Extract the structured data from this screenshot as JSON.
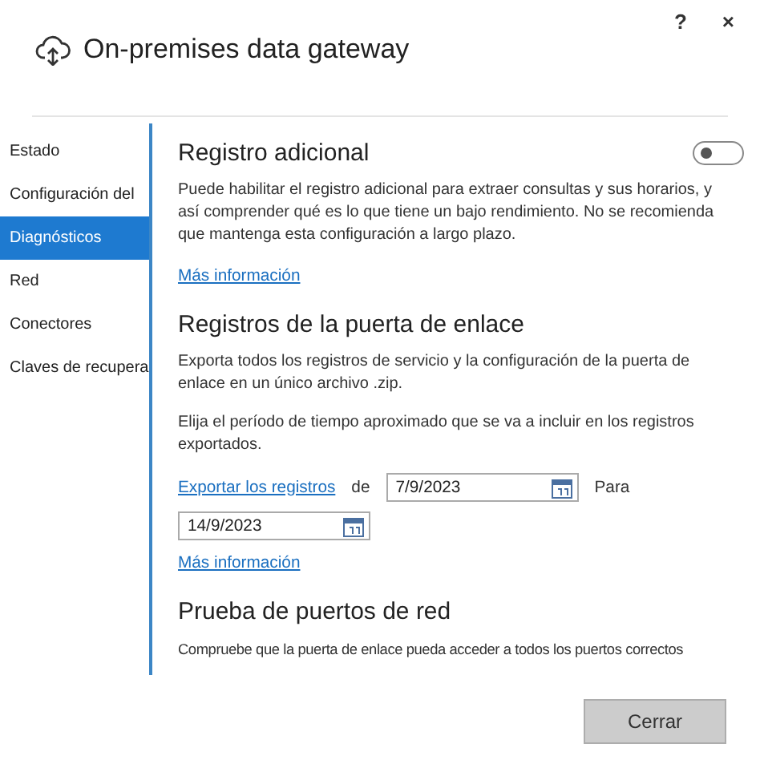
{
  "window": {
    "title": "On-premises data gateway",
    "help": "?",
    "close": "×"
  },
  "sidebar": {
    "items": [
      {
        "label": "Estado",
        "selected": false
      },
      {
        "label": "Configuración del",
        "selected": false
      },
      {
        "label": "Diagnósticos",
        "selected": true
      },
      {
        "label": "Red",
        "selected": false
      },
      {
        "label": "Conectores",
        "selected": false
      },
      {
        "label": "Claves de recupera",
        "selected": false
      }
    ]
  },
  "sections": [
    {
      "title": "Registro adicional",
      "toggle": {
        "on": false
      },
      "paragraphs": [
        "Puede habilitar el registro adicional para extraer consultas y sus horarios, y así comprender qué es lo que tiene un bajo rendimiento. No se recomienda que mantenga esta configuración a largo plazo."
      ],
      "link": "Más información"
    },
    {
      "title": "Registros de la puerta de enlace",
      "paragraphs": [
        "Exporta todos los registros de servicio y la configuración de la puerta de enlace en un único archivo .zip.",
        "Elija el período de tiempo aproximado que se va a incluir en los registros exportados."
      ],
      "export": {
        "link": "Exportar los registros",
        "from_label": "de",
        "from": "7/9/2023",
        "to_label": "Para",
        "to": "14/9/2023"
      },
      "link": "Más información"
    },
    {
      "title": "Prueba de puertos de red",
      "paragraphs": [
        "Compruebe que la puerta de enlace pueda acceder a todos los puertos correctos"
      ]
    }
  ],
  "buttons": [
    "Cerrar"
  ]
}
